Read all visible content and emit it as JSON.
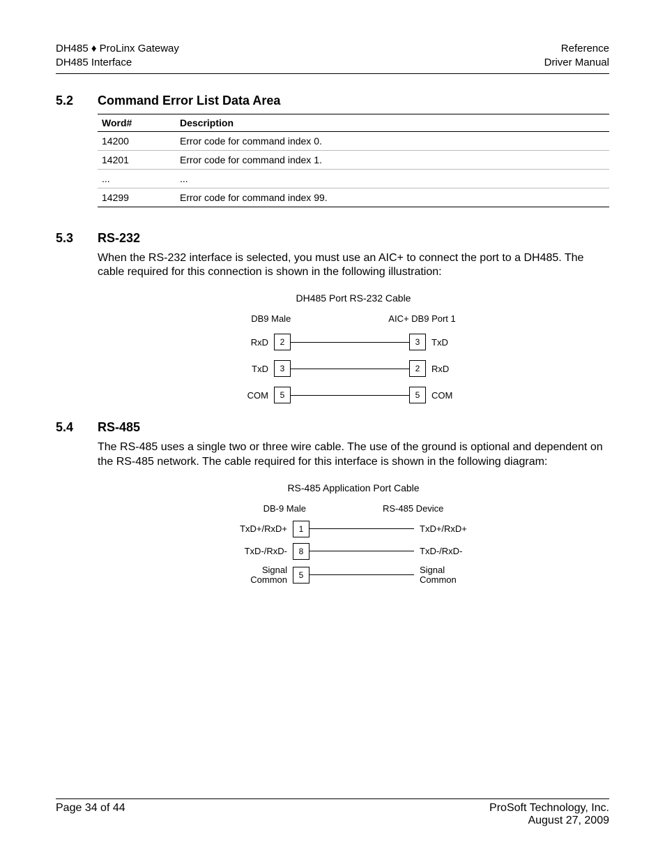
{
  "header": {
    "left_line1": "DH485 ♦ ProLinx Gateway",
    "left_line2": "DH485 Interface",
    "right_line1": "Reference",
    "right_line2": "Driver Manual"
  },
  "section52": {
    "num": "5.2",
    "title": "Command Error List Data Area",
    "table": {
      "headers": {
        "word": "Word#",
        "desc": "Description"
      },
      "rows": [
        {
          "word": "14200",
          "desc": "Error code for command index 0."
        },
        {
          "word": "14201",
          "desc": "Error code for command index 1."
        },
        {
          "word": "...",
          "desc": "..."
        },
        {
          "word": "14299",
          "desc": "Error code for command index 99."
        }
      ]
    }
  },
  "section53": {
    "num": "5.3",
    "title": "RS-232",
    "para": "When the RS-232 interface is selected, you must use an AIC+ to connect the port to a DH485. The cable required for this connection is shown in the following illustration:",
    "diagram": {
      "title": "DH485 Port RS-232 Cable",
      "left_header": "DB9 Male",
      "right_header": "AIC+ DB9 Port 1",
      "rows": [
        {
          "llabel": "RxD",
          "lpin": "2",
          "rpin": "3",
          "rlabel": "TxD"
        },
        {
          "llabel": "TxD",
          "lpin": "3",
          "rpin": "2",
          "rlabel": "RxD"
        },
        {
          "llabel": "COM",
          "lpin": "5",
          "rpin": "5",
          "rlabel": "COM"
        }
      ]
    }
  },
  "section54": {
    "num": "5.4",
    "title": "RS-485",
    "para": "The RS-485 uses a single two or three wire cable. The use of the ground is optional and dependent on the RS-485 network. The cable required for this interface is shown in the following diagram:",
    "diagram": {
      "title": "RS-485 Application Port Cable",
      "left_header": "DB-9 Male",
      "right_header": "RS-485 Device",
      "rows": [
        {
          "llabel": "TxD+/RxD+",
          "lpin": "1",
          "rlabel": "TxD+/RxD+"
        },
        {
          "llabel": "TxD-/RxD-",
          "lpin": "8",
          "rlabel": "TxD-/RxD-"
        },
        {
          "llabel": "Signal Common",
          "lpin": "5",
          "rlabel": "Signal Common"
        }
      ]
    }
  },
  "footer": {
    "page": "Page 34 of 44",
    "company": "ProSoft Technology, Inc.",
    "date": "August 27, 2009"
  }
}
